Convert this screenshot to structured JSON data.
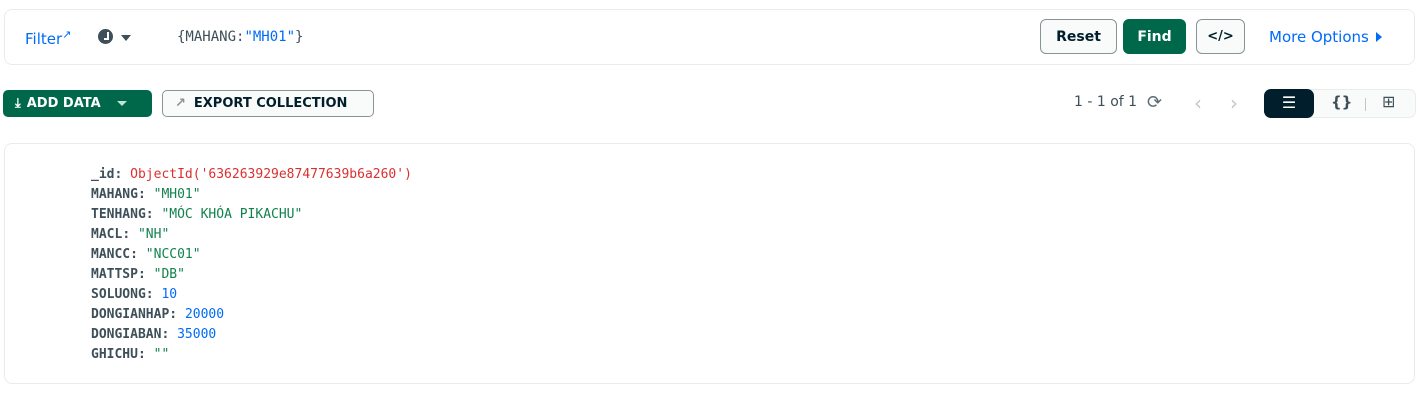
{
  "filter": {
    "label": "Filter",
    "query_prefix": "{MAHANG:",
    "query_value": "\"MH01\"",
    "query_suffix": "}"
  },
  "buttons": {
    "reset": "Reset",
    "find": "Find",
    "code": "</>",
    "more_options": "More Options"
  },
  "toolbar": {
    "add_data": "ADD DATA",
    "export": "EXPORT COLLECTION",
    "pagination": "1 - 1 of 1"
  },
  "document": {
    "fields": [
      {
        "key": "_id",
        "value": "ObjectId('636263929e87477639b6a260')",
        "type": "oid"
      },
      {
        "key": "MAHANG",
        "value": "\"MH01\"",
        "type": "str"
      },
      {
        "key": "TENHANG",
        "value": "\"MÓC KHÓA PIKACHU\"",
        "type": "str"
      },
      {
        "key": "MACL",
        "value": "\"NH\"",
        "type": "str"
      },
      {
        "key": "MANCC",
        "value": "\"NCC01\"",
        "type": "str"
      },
      {
        "key": "MATTSP",
        "value": "\"DB\"",
        "type": "str"
      },
      {
        "key": "SOLUONG",
        "value": "10",
        "type": "num"
      },
      {
        "key": "DONGIANHAP",
        "value": "20000",
        "type": "num"
      },
      {
        "key": "DONGIABAN",
        "value": "35000",
        "type": "num"
      },
      {
        "key": "GHICHU",
        "value": "\"\"",
        "type": "str"
      }
    ]
  }
}
